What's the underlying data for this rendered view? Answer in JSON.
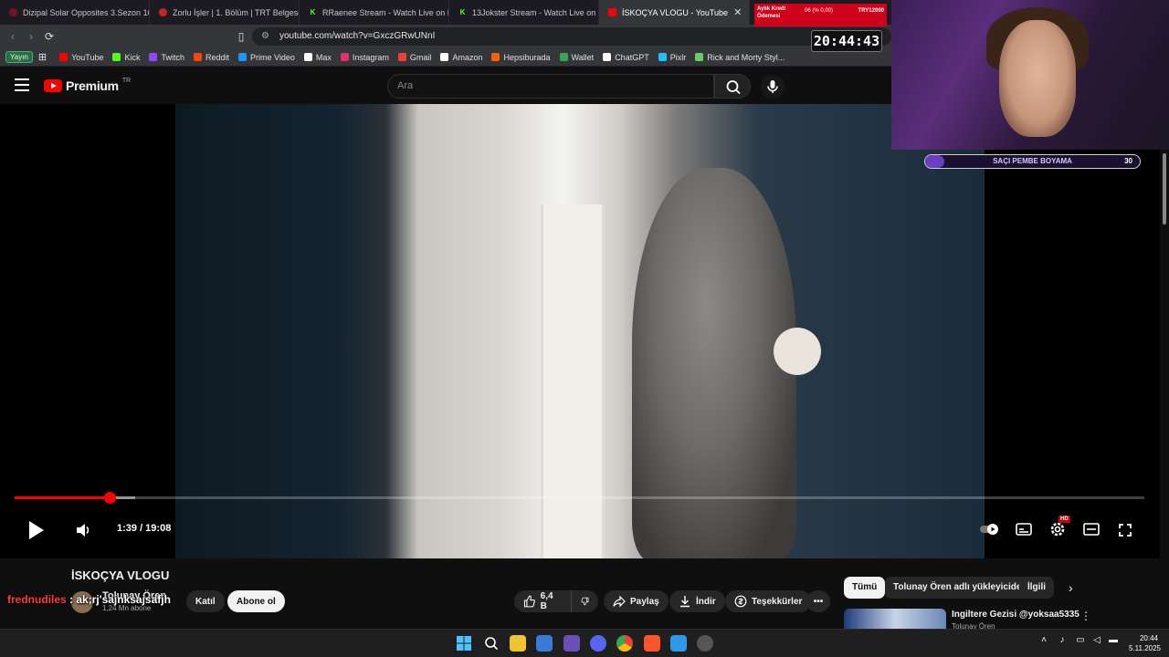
{
  "browser": {
    "tabs": [
      {
        "title": "Dizipal Solar Opposites 3.Sezon 10.B"
      },
      {
        "title": "Zorlu İşler | 1. Bölüm | TRT Belgesel -"
      },
      {
        "title": "RRaenee Stream - Watch Live on Kick"
      },
      {
        "title": "13Jokster Stream - Watch Live on Kic"
      },
      {
        "title": "İSKOÇYA VLOGU - YouTube"
      }
    ],
    "url": "youtube.com/watch?v=GxczGRwUNnI",
    "yayin_label": "Yayın",
    "bookmarks": [
      {
        "label": "YouTube",
        "color": "#ff0000"
      },
      {
        "label": "Kick",
        "color": "#53fc18"
      },
      {
        "label": "Twitch",
        "color": "#9146ff"
      },
      {
        "label": "Reddit",
        "color": "#ff4500"
      },
      {
        "label": "Prime Video",
        "color": "#1a98ff"
      },
      {
        "label": "Max",
        "color": "#ffffff"
      },
      {
        "label": "Instagram",
        "color": "#e1306c"
      },
      {
        "label": "Gmail",
        "color": "#ea4335"
      },
      {
        "label": "Amazon",
        "color": "#ffffff"
      },
      {
        "label": "Hepsiburada",
        "color": "#ff6000"
      },
      {
        "label": "Wallet",
        "color": "#34a853"
      },
      {
        "label": "ChatGPT",
        "color": "#ffffff"
      },
      {
        "label": "Pixlr",
        "color": "#1ec0ff"
      },
      {
        "label": "Rick and Morty Styl...",
        "color": "#66cc66"
      }
    ]
  },
  "youtube": {
    "logo_text": "Premium",
    "logo_region": "TR",
    "search_placeholder": "Ara",
    "player": {
      "time": "1:39 / 19:08",
      "progress_played": 0.084,
      "progress_loaded": 0.107,
      "hd_badge": "HD"
    },
    "video": {
      "title": "İSKOÇYA VLOGU",
      "channel": "Tolunay Ören",
      "subscribers": "1,24 Mn abone",
      "join_label": "Katıl",
      "subscribe_label": "Abone ol",
      "likes": "6,4 B",
      "share_label": "Paylaş",
      "download_label": "İndir",
      "thanks_label": "Teşekkürler"
    },
    "chips": [
      "Tümü",
      "Tolunay Ören adlı yükleyiciden",
      "İlgili"
    ],
    "recommendation": {
      "title": "Ingiltere Gezisi @yoksaa5335",
      "channel": "Tolunay Ören"
    }
  },
  "overlay": {
    "chat_user": "frednudiles",
    "chat_message": ": ak;rj'sajnksajsafjh",
    "clock": "20:44:43",
    "goal_label": "SAÇI PEMBE BOYAMA",
    "goal_count": "30",
    "goal_progress": 0.09,
    "ad_left": "Aylık Kredi Ödemesi",
    "ad_mid": "06 (% 0,00)",
    "ad_right": "TRY12000"
  },
  "taskbar": {
    "time": "20:44",
    "date": "5.11.2025"
  }
}
